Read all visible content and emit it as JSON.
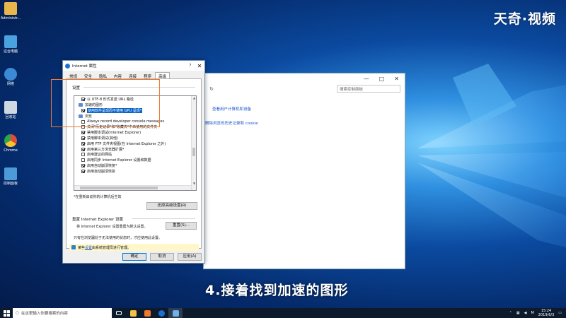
{
  "watermark": "天奇·视频",
  "subtitle": "4.接着找到加速的图形",
  "desktop_icons": [
    {
      "label": "Administr...",
      "icon": "user-folder-icon",
      "color": "#e8b64a"
    },
    {
      "label": "这台电脑",
      "icon": "computer-icon",
      "color": "#4aa3e0"
    },
    {
      "label": "网络",
      "icon": "network-icon",
      "color": "#3c8ad6"
    },
    {
      "label": "回收站",
      "icon": "recycle-bin-icon",
      "color": "#cfd8e2"
    },
    {
      "label": "Chrome",
      "icon": "chrome-icon",
      "color": "#e04b3a"
    },
    {
      "label": "控制面板",
      "icon": "control-panel-icon",
      "color": "#4c9ad8"
    }
  ],
  "back_window": {
    "controls": {
      "minimize": "—",
      "maximize": "□",
      "close": "✕"
    },
    "search_placeholder": "搜索控制面板",
    "links": [
      "查看用户计算机和设备",
      "删除浏览的历史记录和 cookie"
    ]
  },
  "dialog": {
    "title": "Internet 属性",
    "help": "?",
    "close": "✕",
    "tabs": [
      "常规",
      "安全",
      "隐私",
      "内容",
      "连接",
      "程序",
      "高级"
    ],
    "active_tab": "高级",
    "section_label": "设置",
    "tree": [
      {
        "kind": "cb",
        "checked": true,
        "text": "以 UTF-8 形式发送 URL 路径"
      },
      {
        "kind": "group",
        "text": "加速的图形"
      },
      {
        "kind": "cb",
        "checked": true,
        "highlight": true,
        "text": "使用软件呈现而不使用 GPU 呈现*"
      },
      {
        "kind": "group",
        "text": "浏览"
      },
      {
        "kind": "cb",
        "checked": false,
        "text": "Always record developer console messages"
      },
      {
        "kind": "cb",
        "checked": false,
        "text": "关闭\"历史记录\"和\"收藏夹\"中未使用的文件夹"
      },
      {
        "kind": "cb",
        "checked": true,
        "text": "禁用脚本调试(Internet Explorer)"
      },
      {
        "kind": "cb",
        "checked": true,
        "text": "禁用脚本调试(其他)"
      },
      {
        "kind": "cb",
        "checked": true,
        "text": "启用 FTP 文件夹视图(在 Internet Explorer 之外)"
      },
      {
        "kind": "cb",
        "checked": true,
        "text": "启用第三方浏览器扩展*"
      },
      {
        "kind": "cb",
        "checked": false,
        "text": "启用建议的网站"
      },
      {
        "kind": "cb",
        "checked": false,
        "text": "启用同步 Internet Explorer 设置和数据"
      },
      {
        "kind": "cb",
        "checked": true,
        "text": "启用自动崩溃恢复*"
      },
      {
        "kind": "cb",
        "checked": true,
        "text": "启用自动崩溃恢复"
      }
    ],
    "restart_note": "*在重新启动你的计算机后生效",
    "restore_button": "还原高级设置(R)",
    "reset_section_label": "重置 Internet Explorer 设置",
    "reset_desc": "将 Internet Explorer 设置重置为默认设置。",
    "reset_button": "重置(S)...",
    "reset_note": "只有在浏览器处于无法使用的状态时，才应使用此设置。",
    "warn_prefix": "某些",
    "warn_link": "设置",
    "warn_suffix": "由系统管理员进行管理。",
    "ok": "确定",
    "cancel": "取消",
    "apply": "应用(A)"
  },
  "taskbar": {
    "search_placeholder": "在这里输入你要搜索的内容",
    "time": "15:24",
    "date": "2019/6/3",
    "ime": "M"
  }
}
